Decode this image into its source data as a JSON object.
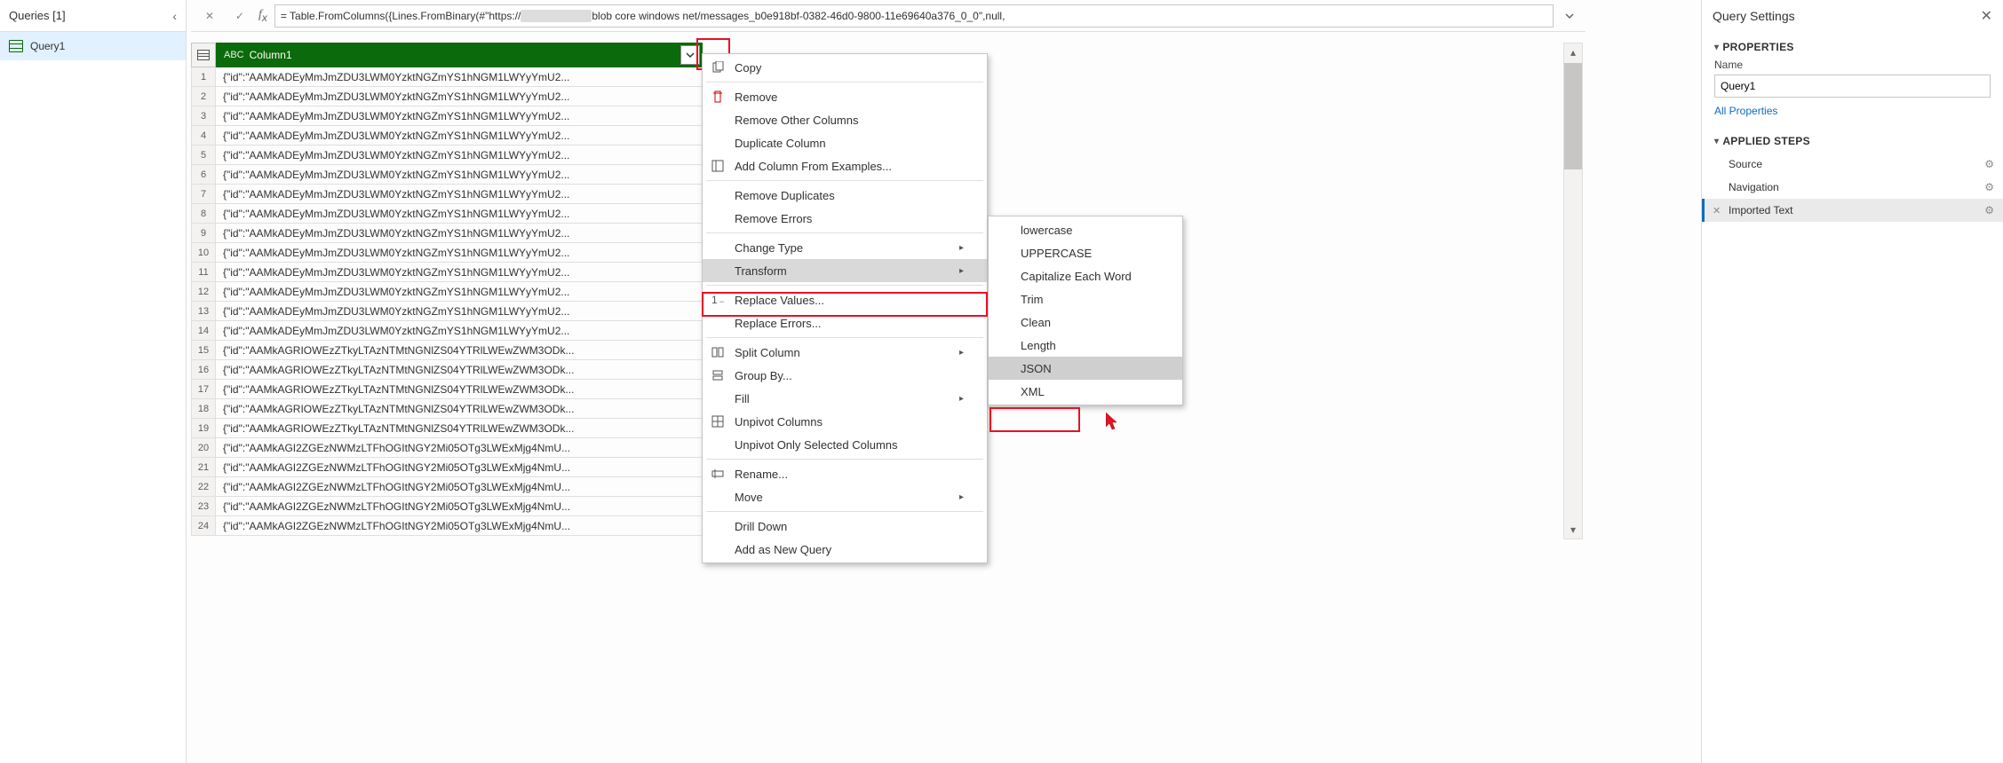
{
  "queries": {
    "header": "Queries [1]",
    "items": [
      "Query1"
    ]
  },
  "formula": {
    "text_prefix": "= Table.FromColumns({Lines.FromBinary(#\"https://",
    "text_suffix": " blob core windows net/messages_b0e918bf-0382-46d0-9800-11e69640a376_0_0\",null,"
  },
  "column": {
    "name": "Column1",
    "type_label": "ABC"
  },
  "rows": [
    "{\"id\":\"AAMkADEyMmJmZDU3LWM0YzktNGZmYS1hNGM1LWYyYmU2...",
    "{\"id\":\"AAMkADEyMmJmZDU3LWM0YzktNGZmYS1hNGM1LWYyYmU2...",
    "{\"id\":\"AAMkADEyMmJmZDU3LWM0YzktNGZmYS1hNGM1LWYyYmU2...",
    "{\"id\":\"AAMkADEyMmJmZDU3LWM0YzktNGZmYS1hNGM1LWYyYmU2...",
    "{\"id\":\"AAMkADEyMmJmZDU3LWM0YzktNGZmYS1hNGM1LWYyYmU2...",
    "{\"id\":\"AAMkADEyMmJmZDU3LWM0YzktNGZmYS1hNGM1LWYyYmU2...",
    "{\"id\":\"AAMkADEyMmJmZDU3LWM0YzktNGZmYS1hNGM1LWYyYmU2...",
    "{\"id\":\"AAMkADEyMmJmZDU3LWM0YzktNGZmYS1hNGM1LWYyYmU2...",
    "{\"id\":\"AAMkADEyMmJmZDU3LWM0YzktNGZmYS1hNGM1LWYyYmU2...",
    "{\"id\":\"AAMkADEyMmJmZDU3LWM0YzktNGZmYS1hNGM1LWYyYmU2...",
    "{\"id\":\"AAMkADEyMmJmZDU3LWM0YzktNGZmYS1hNGM1LWYyYmU2...",
    "{\"id\":\"AAMkADEyMmJmZDU3LWM0YzktNGZmYS1hNGM1LWYyYmU2...",
    "{\"id\":\"AAMkADEyMmJmZDU3LWM0YzktNGZmYS1hNGM1LWYyYmU2...",
    "{\"id\":\"AAMkADEyMmJmZDU3LWM0YzktNGZmYS1hNGM1LWYyYmU2...",
    "{\"id\":\"AAMkAGRIOWEzZTkyLTAzNTMtNGNlZS04YTRlLWEwZWM3ODk...",
    "{\"id\":\"AAMkAGRIOWEzZTkyLTAzNTMtNGNlZS04YTRlLWEwZWM3ODk...",
    "{\"id\":\"AAMkAGRIOWEzZTkyLTAzNTMtNGNlZS04YTRlLWEwZWM3ODk...",
    "{\"id\":\"AAMkAGRIOWEzZTkyLTAzNTMtNGNlZS04YTRlLWEwZWM3ODk...",
    "{\"id\":\"AAMkAGRIOWEzZTkyLTAzNTMtNGNlZS04YTRlLWEwZWM3ODk...",
    "{\"id\":\"AAMkAGI2ZGEzNWMzLTFhOGItNGY2Mi05OTg3LWExMjg4NmU...",
    "{\"id\":\"AAMkAGI2ZGEzNWMzLTFhOGItNGY2Mi05OTg3LWExMjg4NmU...",
    "{\"id\":\"AAMkAGI2ZGEzNWMzLTFhOGItNGY2Mi05OTg3LWExMjg4NmU...",
    "{\"id\":\"AAMkAGI2ZGEzNWMzLTFhOGItNGY2Mi05OTg3LWExMjg4NmU...",
    "{\"id\":\"AAMkAGI2ZGEzNWMzLTFhOGItNGY2Mi05OTg3LWExMjg4NmU..."
  ],
  "context_menu": {
    "items": [
      {
        "label": "Copy",
        "icon": "copy"
      },
      {
        "sep": true
      },
      {
        "label": "Remove",
        "icon": "remove"
      },
      {
        "label": "Remove Other Columns"
      },
      {
        "label": "Duplicate Column"
      },
      {
        "label": "Add Column From Examples...",
        "icon": "add-col"
      },
      {
        "sep": true
      },
      {
        "label": "Remove Duplicates"
      },
      {
        "label": "Remove Errors"
      },
      {
        "sep": true
      },
      {
        "label": "Change Type",
        "arrow": true
      },
      {
        "label": "Transform",
        "arrow": true,
        "hovered": true
      },
      {
        "sep": true
      },
      {
        "label": "Replace Values...",
        "icon": "replace"
      },
      {
        "label": "Replace Errors..."
      },
      {
        "sep": true
      },
      {
        "label": "Split Column",
        "arrow": true,
        "icon": "split"
      },
      {
        "label": "Group By...",
        "icon": "group"
      },
      {
        "label": "Fill",
        "arrow": true
      },
      {
        "label": "Unpivot Columns",
        "icon": "unpivot"
      },
      {
        "label": "Unpivot Only Selected Columns"
      },
      {
        "sep": true
      },
      {
        "label": "Rename...",
        "icon": "rename"
      },
      {
        "label": "Move",
        "arrow": true
      },
      {
        "sep": true
      },
      {
        "label": "Drill Down"
      },
      {
        "label": "Add as New Query"
      }
    ]
  },
  "submenu": {
    "items": [
      {
        "label": "lowercase"
      },
      {
        "label": "UPPERCASE"
      },
      {
        "label": "Capitalize Each Word"
      },
      {
        "label": "Trim"
      },
      {
        "label": "Clean"
      },
      {
        "label": "Length"
      },
      {
        "label": "JSON",
        "hovered": true
      },
      {
        "label": "XML"
      }
    ]
  },
  "settings": {
    "title": "Query Settings",
    "properties_title": "PROPERTIES",
    "name_label": "Name",
    "name_value": "Query1",
    "all_properties": "All Properties",
    "steps_title": "APPLIED STEPS",
    "steps": [
      {
        "label": "Source",
        "gear": true
      },
      {
        "label": "Navigation",
        "gear": true
      },
      {
        "label": "Imported Text",
        "selected": true,
        "gear": true,
        "x": true
      }
    ]
  }
}
